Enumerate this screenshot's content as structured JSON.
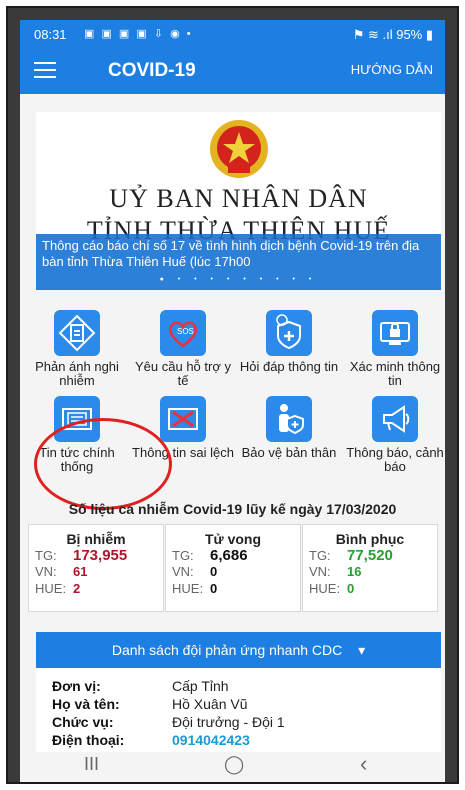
{
  "status": {
    "time": "08:31",
    "icons": "▣ ▣ ▣ ▣ ⇩ ◉ •",
    "right": "⚑ ≋ .ıl 95% ▮"
  },
  "appbar": {
    "title": "COVID-19",
    "help": "HƯỚNG DẪN"
  },
  "banner": {
    "line1": "UỶ BAN NHÂN DÂN",
    "line2": "TỈNH THỪA THIÊN HUẾ",
    "caption": "Thông cáo báo chí số 17 về tình hình dịch bệnh Covid-19 trên địa bàn tỉnh Thừa Thiên Huế (lúc 17h00",
    "dots": "● • • • • • • • • •"
  },
  "tiles_row1": [
    {
      "label": "Phản ánh nghi nhiễm"
    },
    {
      "label": "Yêu cầu hỗ trợ y tế"
    },
    {
      "label": "Hỏi đáp thông tin"
    },
    {
      "label": "Xác minh thông tin"
    }
  ],
  "tiles_row2": [
    {
      "label": "Tin tức chính thống"
    },
    {
      "label": "Thông tin sai lệch"
    },
    {
      "label": "Bảo vệ bản thân"
    },
    {
      "label": "Thông báo, cảnh báo"
    }
  ],
  "stats": {
    "title": "Số liệu ca nhiễm Covid-19 lũy kế ngày 17/03/2020",
    "label_tg": "TG:",
    "label_vn": "VN:",
    "label_hue": "HUE:",
    "infected": {
      "title": "Bị nhiễm",
      "tg": "173,955",
      "vn": "61",
      "hue": "2"
    },
    "deaths": {
      "title": "Tử vong",
      "tg": "6,686",
      "vn": "0",
      "hue": "0"
    },
    "recovered": {
      "title": "Bình phục",
      "tg": "77,520",
      "vn": "16",
      "hue": "0"
    }
  },
  "cdc": {
    "header": "Danh sách đội phản ứng nhanh CDC",
    "unit_label": "Đơn vị:",
    "unit": "Cấp Tỉnh",
    "name_label": "Họ và tên:",
    "name": "Hồ Xuân Vũ",
    "position_label": "Chức vụ:",
    "position": "Đội trưởng - Đội 1",
    "phone_label": "Điện thoại:",
    "phone": "0914042423"
  },
  "nav": {
    "recent": "III",
    "home": "◯",
    "back": "‹"
  },
  "colors": {
    "primary": "#1e7fe3",
    "highlight": "#e0211f",
    "infected": "#b0142b",
    "recovered": "#27a02d",
    "phone": "#1a9bd6"
  }
}
